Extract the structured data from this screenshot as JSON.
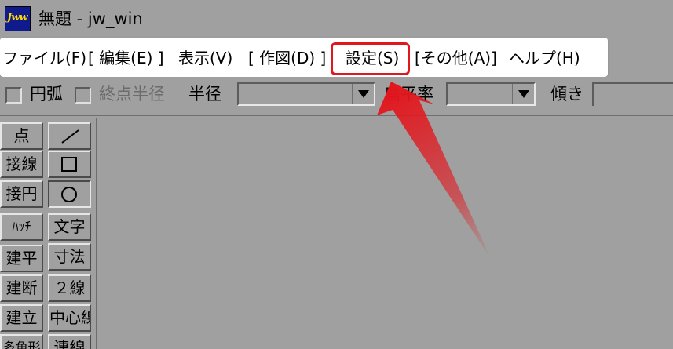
{
  "window": {
    "app_icon_text": "Jww",
    "title": "無題 - jw_win"
  },
  "menu": {
    "items": [
      {
        "label": "ファイル(F)"
      },
      {
        "label": "[ 編集(E) ]"
      },
      {
        "label": "表示(V)"
      },
      {
        "label": "[ 作図(D) ]"
      },
      {
        "label": "設定(S)"
      },
      {
        "label": "[その他(A)]"
      },
      {
        "label": "ヘルプ(H)"
      }
    ],
    "highlighted": "設定(S)"
  },
  "toolbar": {
    "arc_checkbox_label": "円弧",
    "end_radius_checkbox_label": "終点半径",
    "radius_label": "半径",
    "flatness_label": "扁平率",
    "tilt_label": "傾き"
  },
  "tools": {
    "left": [
      "点",
      "接線",
      "接円",
      "ﾊｯﾁ",
      "建平",
      "建断",
      "建立",
      "多角形"
    ],
    "right": [
      "line-tool-icon",
      "rectangle-tool-icon",
      "circle-tool-icon",
      "文字",
      "寸法",
      "２線",
      "中心線",
      "連線"
    ]
  },
  "colors": {
    "highlight_border": "#e3161d",
    "arrow": "#e3161d",
    "window_bg": "#a0a0a0",
    "menu_bg": "#ffffff",
    "app_icon_bg": "#0f1a8c",
    "app_icon_text": "#ffd800"
  }
}
